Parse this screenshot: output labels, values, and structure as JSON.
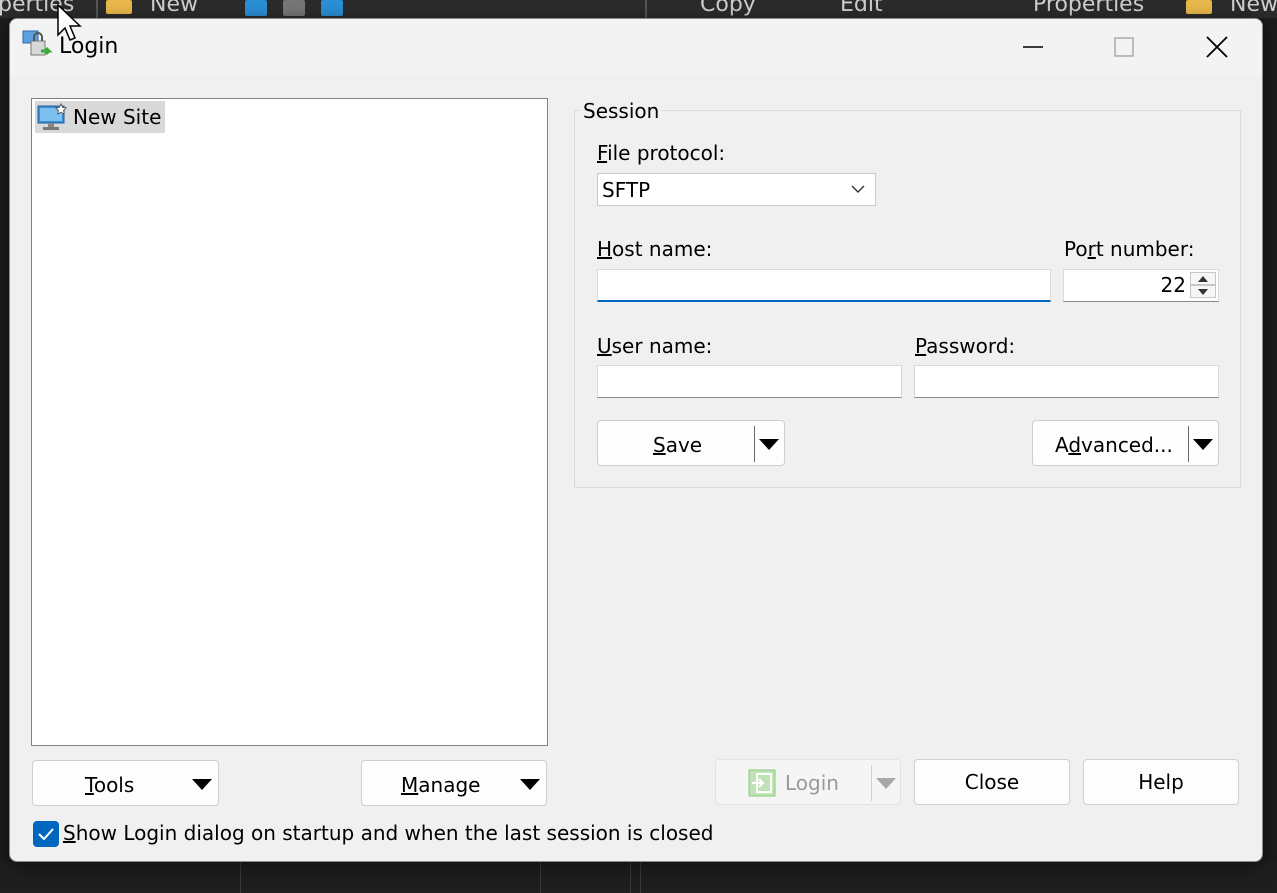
{
  "background": {
    "toolbar_texts": [
      "perties",
      "New",
      "Copy",
      "Edit",
      "Properties",
      "New"
    ]
  },
  "dialog": {
    "title": "Login",
    "window_controls": [
      "minimize-icon",
      "maximize-icon",
      "close-icon"
    ]
  },
  "site_tree": {
    "items": [
      {
        "label": "New Site",
        "icon": "new-site-icon",
        "selected": true
      }
    ]
  },
  "session": {
    "group_title": "Session",
    "file_protocol": {
      "label_mn": "F",
      "label_rest": "ile protocol:",
      "value": "SFTP"
    },
    "host_name": {
      "label_mn": "H",
      "label_rest": "ost name:",
      "value": ""
    },
    "port_number": {
      "label_pre": "Po",
      "label_mn": "r",
      "label_rest": "t number:",
      "value": "22"
    },
    "user_name": {
      "label_mn": "U",
      "label_rest": "ser name:",
      "value": ""
    },
    "password": {
      "label_mn": "P",
      "label_rest": "assword:",
      "value": ""
    },
    "save_button": {
      "mn": "S",
      "rest": "ave"
    },
    "advanced_button": {
      "pre": "A",
      "mn": "d",
      "rest": "vanced..."
    }
  },
  "bottom": {
    "tools_button": {
      "mn": "T",
      "rest": "ools"
    },
    "manage_button": {
      "mn": "M",
      "rest": "anage"
    },
    "login_button": "Login",
    "close_button": "Close",
    "help_button": "Help",
    "startup_checkbox": {
      "checked": true,
      "mn": "S",
      "rest": "how Login dialog on startup and when the last session is closed"
    }
  },
  "colors": {
    "accent": "#0067c0",
    "dialog_bg": "#f0f0f0",
    "disabled_text": "#9a9a9a"
  }
}
